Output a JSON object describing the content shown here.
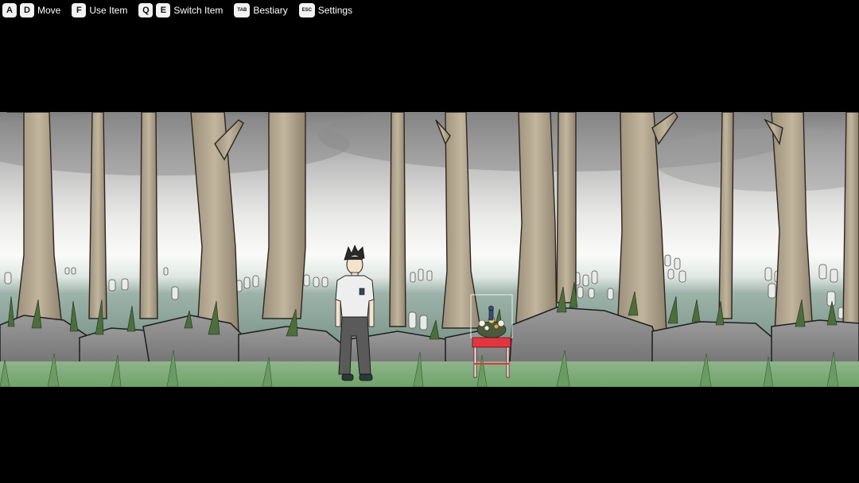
{
  "hud": {
    "controls": [
      {
        "keys": [
          "A",
          "D"
        ],
        "label": "Move"
      },
      {
        "keys": [
          "F"
        ],
        "label": "Use Item"
      },
      {
        "keys": [
          "Q",
          "E"
        ],
        "label": "Switch Item"
      },
      {
        "keys": [
          "TAB"
        ],
        "label": "Bestiary"
      },
      {
        "keys": [
          "ESC"
        ],
        "label": "Settings"
      }
    ]
  },
  "scene": {
    "setting": "foggy-cemetery-forest",
    "colors": {
      "sky_top": "#8a8a8a",
      "fog": "#f4f5f3",
      "field": "#6f8f82",
      "rock": "#8c8c8c",
      "grass": "#4f6e3e",
      "trunk": "#b6a992",
      "table_red": "#e2363f"
    }
  }
}
